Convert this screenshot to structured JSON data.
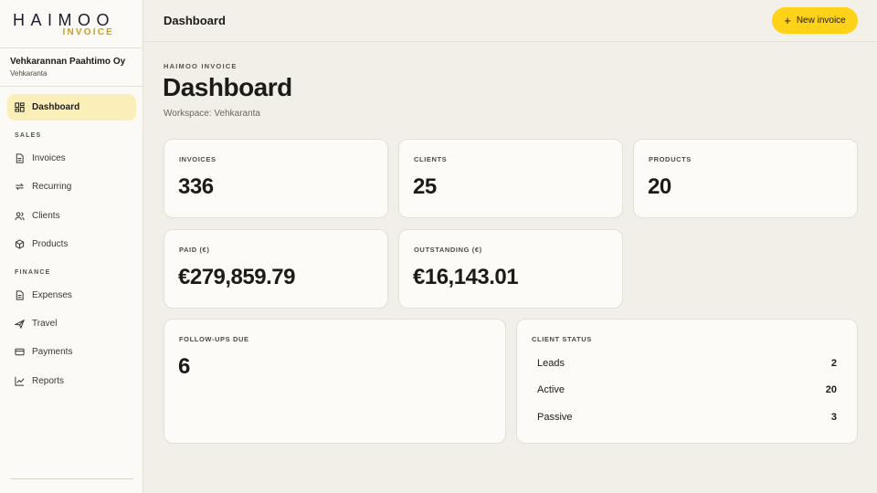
{
  "logo": {
    "main": "HAIMOO",
    "sub": "INVOICE"
  },
  "org": {
    "name": "Vehkarannan Paahtimo Oy",
    "workspace": "Vehkaranta"
  },
  "nav": {
    "dashboard": "Dashboard",
    "sales_label": "SALES",
    "invoices": "Invoices",
    "recurring": "Recurring",
    "clients": "Clients",
    "products": "Products",
    "finance_label": "FINANCE",
    "expenses": "Expenses",
    "travel": "Travel",
    "payments": "Payments",
    "reports": "Reports"
  },
  "topbar": {
    "title": "Dashboard",
    "new_invoice": "New invoice"
  },
  "main": {
    "eyebrow": "HAIMOO INVOICE",
    "title": "Dashboard",
    "workspace": "Workspace: Vehkaranta"
  },
  "stats": {
    "invoices": {
      "label": "INVOICES",
      "value": "336"
    },
    "clients": {
      "label": "CLIENTS",
      "value": "25"
    },
    "products": {
      "label": "PRODUCTS",
      "value": "20"
    },
    "paid": {
      "label": "PAID (€)",
      "value": "€279,859.79"
    },
    "outstanding": {
      "label": "OUTSTANDING (€)",
      "value": "€16,143.01"
    },
    "followups": {
      "label": "FOLLOW-UPS DUE",
      "value": "6"
    }
  },
  "client_status": {
    "label": "CLIENT STATUS",
    "rows": [
      {
        "name": "Leads",
        "count": "2"
      },
      {
        "name": "Active",
        "count": "20"
      },
      {
        "name": "Passive",
        "count": "3"
      }
    ]
  },
  "colors": {
    "accent": "#ffd21a",
    "active_nav": "#fbefb9",
    "logo_gold": "#c9a21c"
  }
}
